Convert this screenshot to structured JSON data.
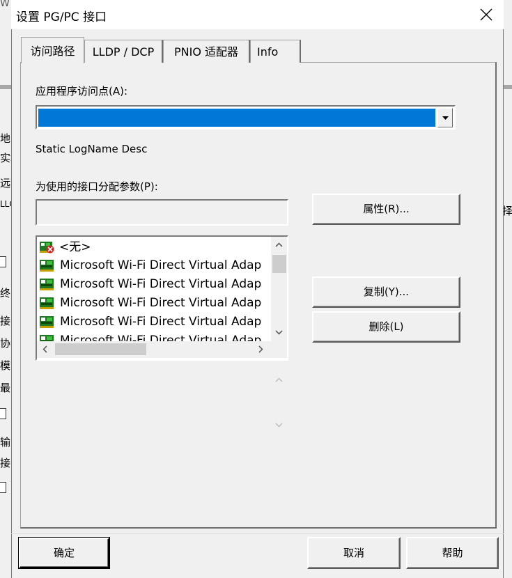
{
  "background_window": {
    "left_fragments": [
      "W",
      "地",
      "实地",
      "远程",
      "LLC",
      "终",
      "接口",
      "协议",
      "模式",
      "最高",
      "输",
      "接收"
    ],
    "right_fragments": [
      "择"
    ]
  },
  "dialog": {
    "title": "设置 PG/PC 接口",
    "tabs": [
      {
        "label": "访问路径",
        "active": true
      },
      {
        "label": "LLDP / DCP",
        "active": false
      },
      {
        "label": "PNIO 适配器",
        "active": false
      },
      {
        "label": "Info",
        "active": false
      }
    ],
    "access_point_label": "应用程序访问点(A):",
    "access_point_value": "",
    "static_text": "Static LogName Desc",
    "params_label": "为使用的接口分配参数(P):",
    "params_value": "",
    "properties_button": "属性(R)...",
    "copy_button": "复制(Y)...",
    "delete_button": "删除(L)",
    "interfaces": [
      {
        "label": "<无>",
        "icon": "no-interface-icon"
      },
      {
        "label": "Microsoft Wi-Fi Direct Virtual Adap",
        "icon": "network-card-icon"
      },
      {
        "label": "Microsoft Wi-Fi Direct Virtual Adap",
        "icon": "network-card-icon"
      },
      {
        "label": "Microsoft Wi-Fi Direct Virtual Adap",
        "icon": "network-card-icon"
      },
      {
        "label": "Microsoft Wi-Fi Direct Virtual Adap",
        "icon": "network-card-icon"
      },
      {
        "label": "Microsoft Wi-Fi Direct Virtual Adap",
        "icon": "network-card-icon"
      }
    ],
    "ok_button": "确定",
    "cancel_button": "取消",
    "help_button": "帮助"
  },
  "colors": {
    "selection": "#0078d7",
    "dialog_bg": "#f0f0f0",
    "icon_green": "#1f7a1f",
    "icon_red": "#d42020"
  }
}
